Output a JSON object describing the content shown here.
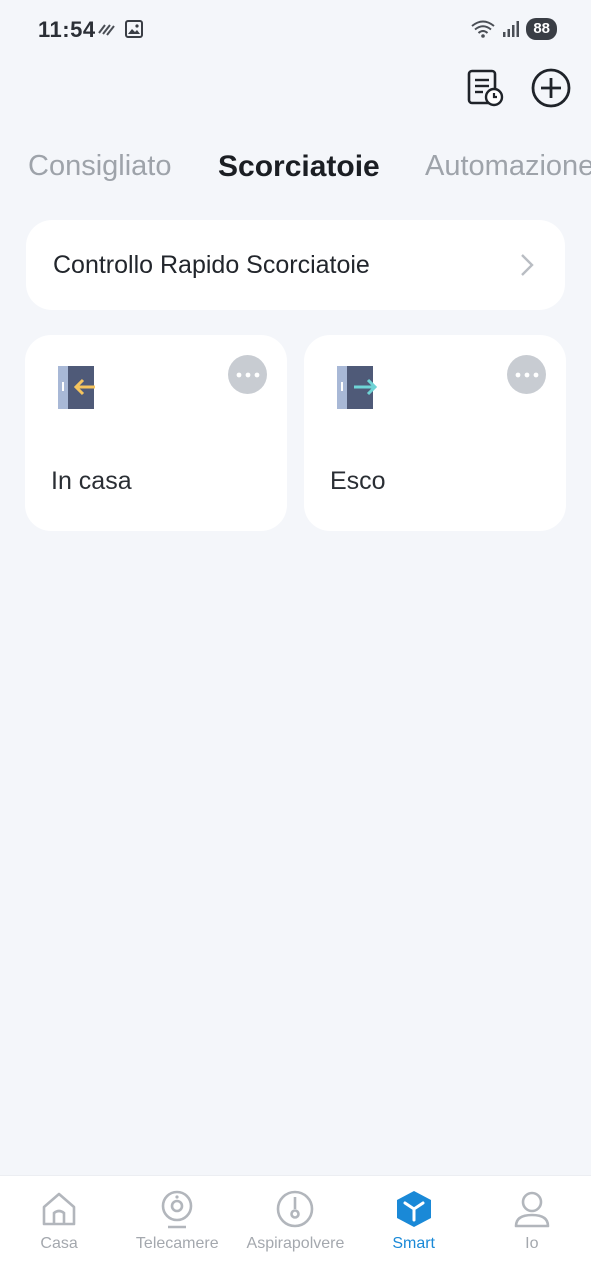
{
  "status_bar": {
    "time": "11:54",
    "battery": "88"
  },
  "header": {
    "history_icon": "document-clock-icon",
    "add_icon": "plus-circle-icon"
  },
  "tabs": [
    {
      "label": "Consigliato",
      "active": false
    },
    {
      "label": "Scorciatoie",
      "active": true
    },
    {
      "label": "Automazione",
      "active": false
    }
  ],
  "quick_control": {
    "label": "Controllo Rapido Scorciatoie"
  },
  "scenes": [
    {
      "name": "In casa",
      "icon": "door-enter-icon",
      "arrow_color": "#f5c45e"
    },
    {
      "name": "Esco",
      "icon": "door-exit-icon",
      "arrow_color": "#6fd4d6"
    }
  ],
  "bottom_nav": [
    {
      "label": "Casa",
      "icon": "home-icon",
      "active": false
    },
    {
      "label": "Telecamere",
      "icon": "camera-icon",
      "active": false
    },
    {
      "label": "Aspirapolvere",
      "icon": "vacuum-icon",
      "active": false
    },
    {
      "label": "Smart",
      "icon": "smart-cube-icon",
      "active": true
    },
    {
      "label": "Io",
      "icon": "user-icon",
      "active": false
    }
  ],
  "colors": {
    "accent": "#1a89d7",
    "background": "#f4f6fa",
    "inactive": "#a4a8ae"
  }
}
